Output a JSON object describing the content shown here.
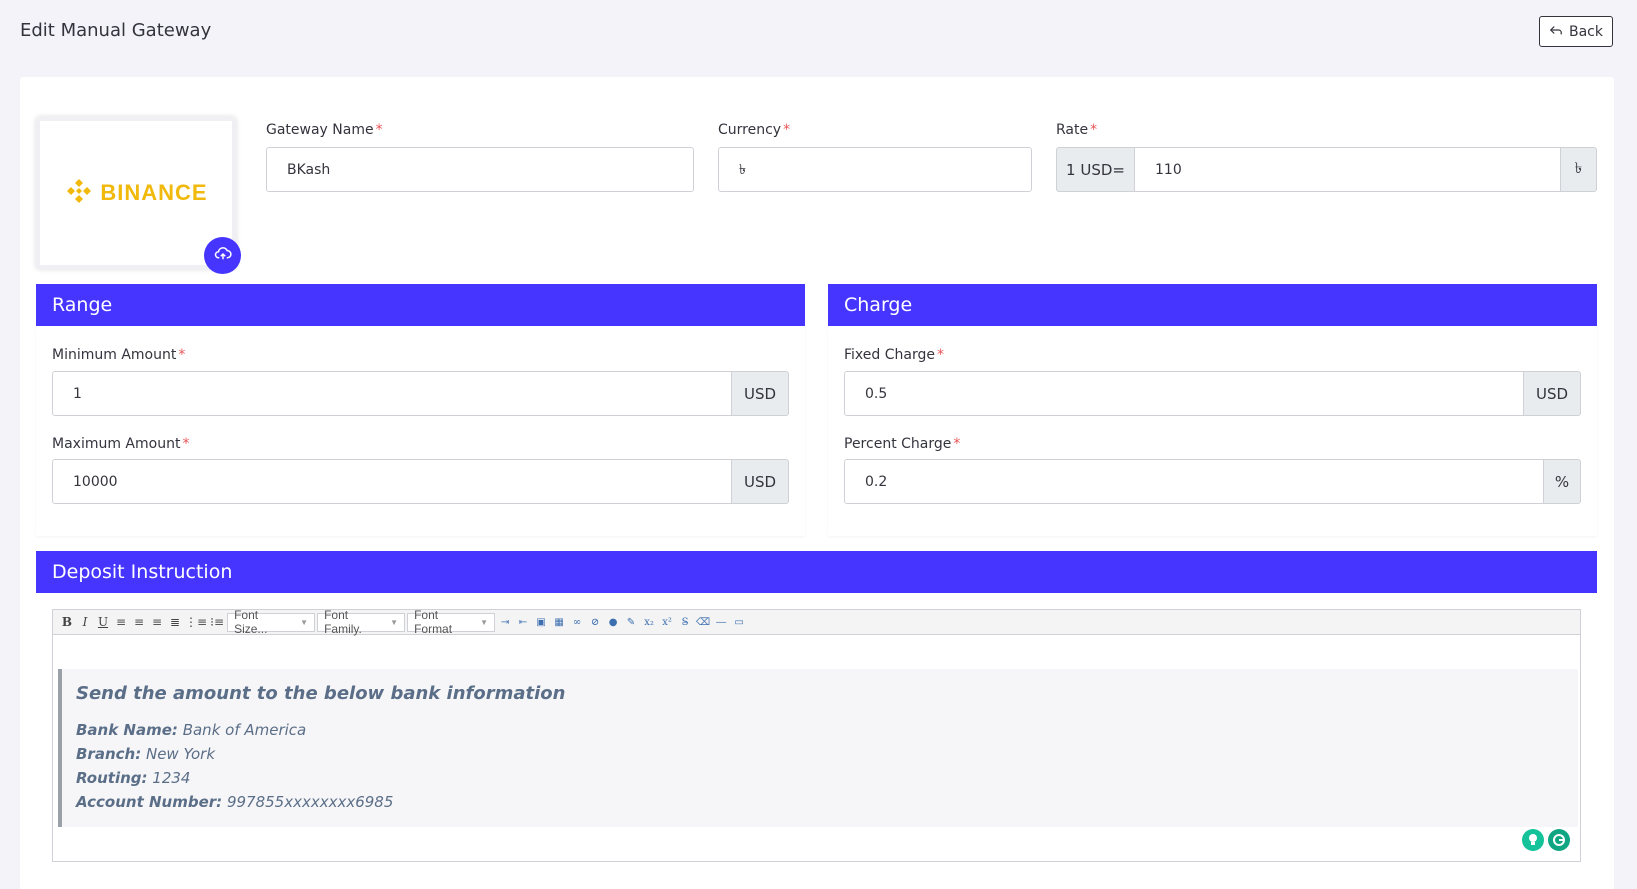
{
  "header": {
    "title": "Edit Manual Gateway",
    "back_label": "Back"
  },
  "logo": {
    "text": "BINANCE",
    "color": "#f0b90b"
  },
  "gateway": {
    "name_label": "Gateway Name",
    "name_value": "BKash",
    "currency_label": "Currency",
    "currency_value": "৳",
    "rate_label": "Rate",
    "rate_prefix": "1 USD=",
    "rate_value": "110",
    "rate_suffix": "৳",
    "required_mark": "*"
  },
  "range": {
    "title": "Range",
    "min_label": "Minimum Amount",
    "min_value": "1",
    "min_unit": "USD",
    "max_label": "Maximum Amount",
    "max_value": "10000",
    "max_unit": "USD"
  },
  "charge": {
    "title": "Charge",
    "fixed_label": "Fixed Charge",
    "fixed_value": "0.5",
    "fixed_unit": "USD",
    "percent_label": "Percent Charge",
    "percent_value": "0.2",
    "percent_unit": "%"
  },
  "deposit": {
    "title": "Deposit Instruction",
    "toolbar": {
      "bold": "B",
      "italic": "I",
      "underline": "U",
      "font_size": "Font Size...",
      "font_family": "Font Family.",
      "font_format": "Font Format"
    },
    "content": {
      "heading": "Send the amount to the below bank information",
      "lines": [
        {
          "label": "Bank Name:",
          "value": "Bank of America"
        },
        {
          "label": "Branch:",
          "value": "New York"
        },
        {
          "label": "Routing:",
          "value": "1234"
        },
        {
          "label": "Account Number:",
          "value": "997855xxxxxxxx6985"
        }
      ]
    }
  },
  "colors": {
    "primary": "#4634ff",
    "required": "#ea5455"
  }
}
